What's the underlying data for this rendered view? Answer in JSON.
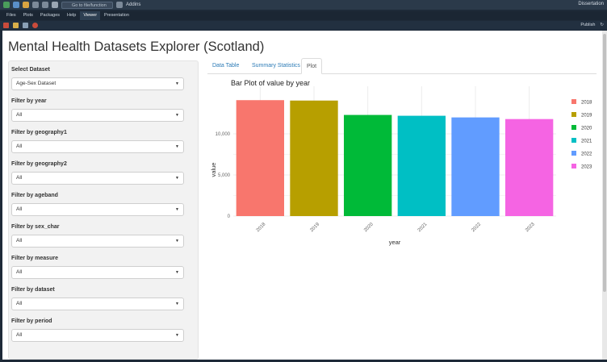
{
  "toolbar": {
    "goto_placeholder": "Go to file/function",
    "addins": "Addins",
    "project": "Dissertation"
  },
  "pane_tabs": [
    "Files",
    "Plots",
    "Packages",
    "Help",
    "Viewer",
    "Presentation"
  ],
  "active_pane_tab": "Viewer",
  "viewer": {
    "publish": "Publish"
  },
  "app": {
    "title": "Mental Health Datasets Explorer (Scotland)",
    "filters": [
      {
        "label": "Select Dataset",
        "value": "Age-Sex Dataset"
      },
      {
        "label": "Filter by year",
        "value": "All"
      },
      {
        "label": "Filter by geography1",
        "value": "All"
      },
      {
        "label": "Filter by geography2",
        "value": "All"
      },
      {
        "label": "Filter by ageband",
        "value": "All"
      },
      {
        "label": "Filter by sex_char",
        "value": "All"
      },
      {
        "label": "Filter by measure",
        "value": "All"
      },
      {
        "label": "Filter by dataset",
        "value": "All"
      },
      {
        "label": "Filter by period",
        "value": "All"
      }
    ],
    "tabs": [
      "Data Table",
      "Summary Statistics",
      "Plot"
    ],
    "active_tab": "Plot"
  },
  "chart_data": {
    "type": "bar",
    "title": "Bar Plot of value by year",
    "xlabel": "year",
    "ylabel": "value",
    "categories": [
      "2018",
      "2019",
      "2020",
      "2021",
      "2022",
      "2023"
    ],
    "values": [
      14100,
      14050,
      12300,
      12200,
      12000,
      11800
    ],
    "ylim": [
      0,
      15200
    ],
    "yticks": [
      0,
      5000,
      10000
    ],
    "ytick_labels": [
      "0",
      "5,000",
      "10,000"
    ],
    "colors": [
      "#F8766D",
      "#B79F00",
      "#00BA38",
      "#00BFC4",
      "#619CFF",
      "#F564E3"
    ],
    "legend": {
      "placement": "right",
      "entries": [
        "2018",
        "2019",
        "2020",
        "2021",
        "2022",
        "2023"
      ]
    },
    "grid": true
  }
}
